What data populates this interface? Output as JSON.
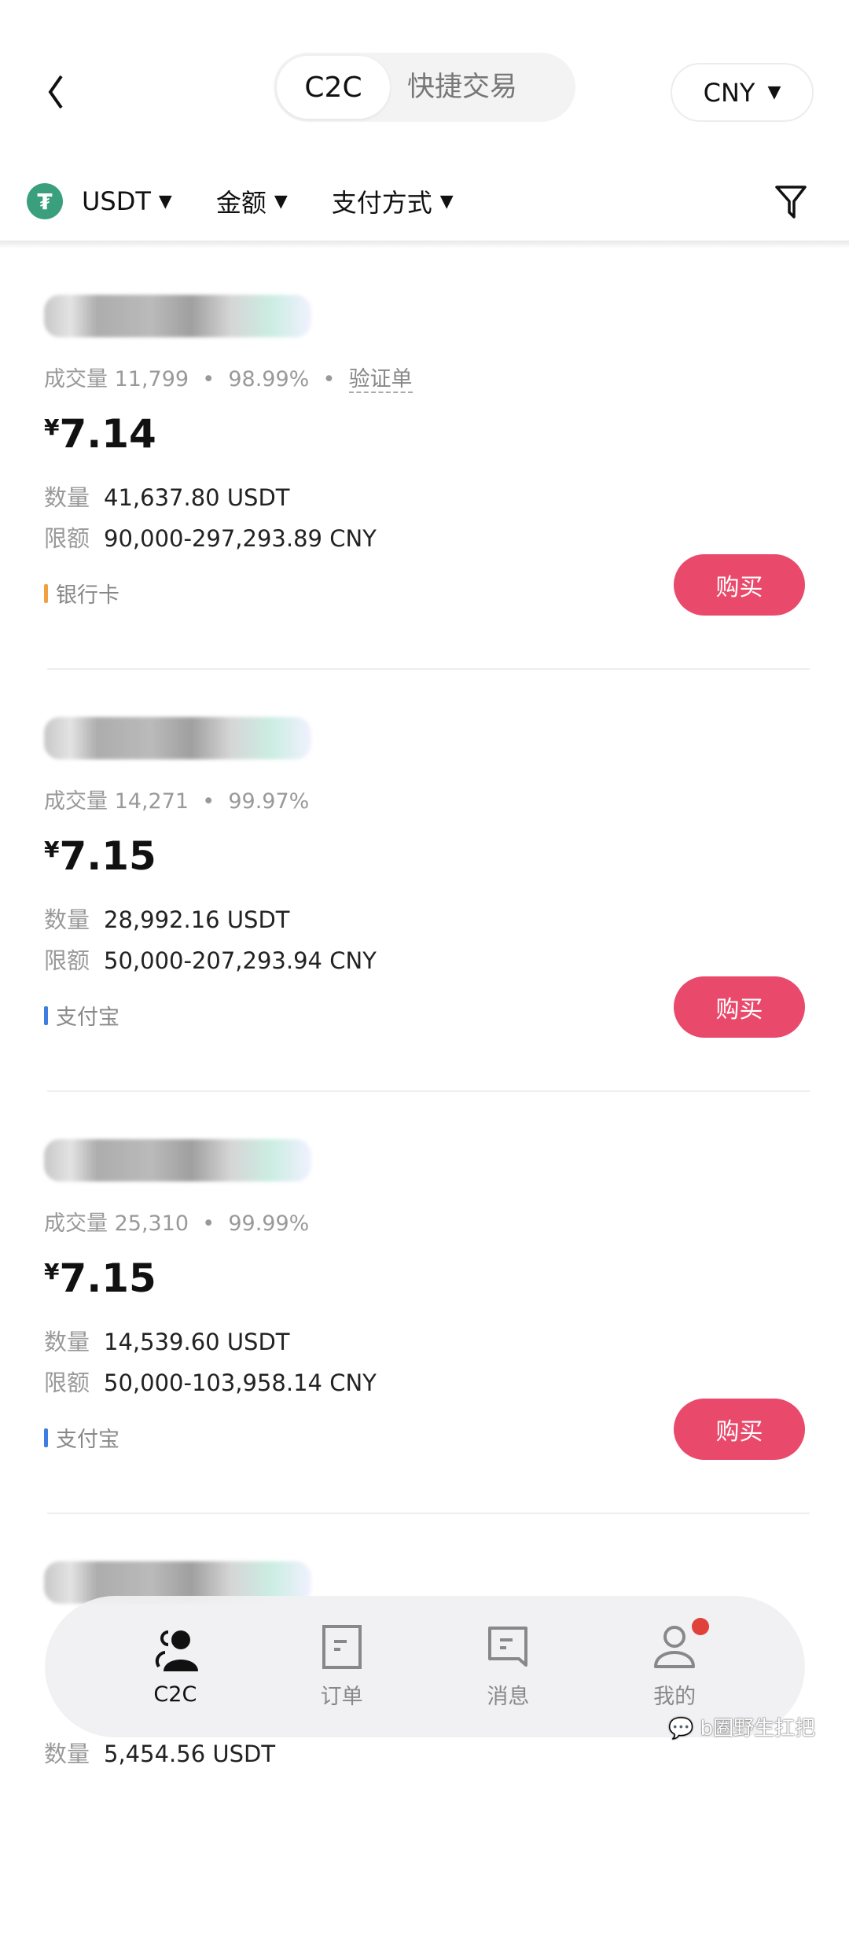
{
  "header": {
    "tabs": [
      {
        "label": "C2C",
        "active": true
      },
      {
        "label": "快捷交易",
        "active": false
      }
    ],
    "currency": "CNY"
  },
  "filters": {
    "coin": "USDT",
    "amount": "金额",
    "payment": "支付方式"
  },
  "listings": [
    {
      "stats_label": "成交量",
      "trades": "11,799",
      "rate": "98.99%",
      "verify": "验证单",
      "yen": "¥",
      "price": "7.14",
      "qty_label": "数量",
      "qty": "41,637.80 USDT",
      "limit_label": "限额",
      "limit": "90,000-297,293.89 CNY",
      "payment": "银行卡",
      "payment_color": "#f0a040",
      "buy": "购买"
    },
    {
      "stats_label": "成交量",
      "trades": "14,271",
      "rate": "99.97%",
      "yen": "¥",
      "price": "7.15",
      "qty_label": "数量",
      "qty": "28,992.16 USDT",
      "limit_label": "限额",
      "limit": "50,000-207,293.94 CNY",
      "payment": "支付宝",
      "payment_color": "#3f7de0",
      "buy": "购买"
    },
    {
      "stats_label": "成交量",
      "trades": "25,310",
      "rate": "99.99%",
      "yen": "¥",
      "price": "7.15",
      "qty_label": "数量",
      "qty": "14,539.60 USDT",
      "limit_label": "限额",
      "limit": "50,000-103,958.14 CNY",
      "payment": "支付宝",
      "payment_color": "#3f7de0",
      "buy": "购买"
    },
    {
      "qty_label": "数量",
      "qty": "5,454.56 USDT"
    }
  ],
  "bottom_nav": [
    {
      "label": "C2C",
      "icon": "users-icon",
      "active": true
    },
    {
      "label": "订单",
      "icon": "order-icon"
    },
    {
      "label": "消息",
      "icon": "message-icon"
    },
    {
      "label": "我的",
      "icon": "profile-icon",
      "badge": true
    }
  ],
  "watermark": "b圈野生扛把",
  "colors": {
    "accent": "#e94a6b",
    "tether": "#3a9f7c",
    "badge": "#e0413a"
  }
}
